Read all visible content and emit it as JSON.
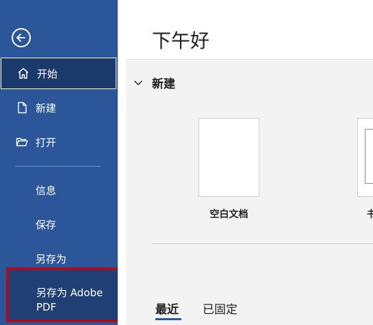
{
  "sidebar": {
    "back_icon": "back-arrow-icon",
    "items": [
      {
        "label": "开始",
        "icon": "home-icon",
        "active": true
      },
      {
        "label": "新建",
        "icon": "new-document-icon"
      },
      {
        "label": "打开",
        "icon": "open-folder-icon"
      }
    ],
    "secondary_items": [
      {
        "label": "信息"
      },
      {
        "label": "保存"
      },
      {
        "label": "另存为"
      },
      {
        "label": "另存为 Adobe\nPDF",
        "highlighted": true
      }
    ]
  },
  "main": {
    "greeting": "下午好",
    "new_section": {
      "title": "新建",
      "templates": [
        {
          "label": "空白文档"
        },
        {
          "label": "书"
        }
      ]
    },
    "tabs": [
      {
        "label": "最近",
        "active": true
      },
      {
        "label": "已固定"
      }
    ]
  },
  "colors": {
    "sidebar_bg": "#2b579a",
    "active_item_bg": "#1a3a6b",
    "highlight_border": "#a80f1e"
  }
}
